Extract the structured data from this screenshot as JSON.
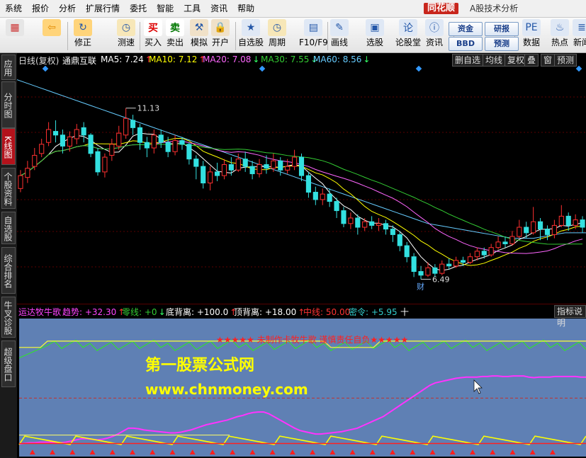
{
  "menu": [
    "系统",
    "报价",
    "分析",
    "扩展行情",
    "委托",
    "智能",
    "工具",
    "资讯",
    "帮助"
  ],
  "brand": {
    "logo": "同花顺",
    "subtitle": "A股技术分析"
  },
  "toolbar": {
    "items": [
      {
        "name": "color-button",
        "label": "",
        "icon": "grid-icon"
      },
      {
        "name": "back-button",
        "label": "",
        "icon": "left-arrow-icon"
      },
      {
        "name": "fix-button",
        "label": "修正",
        "icon": "fix-icon"
      },
      {
        "name": "speed-button",
        "label": "测速",
        "icon": "clock-icon"
      },
      {
        "name": "buy-button",
        "label": "买入",
        "icon": "buy-icon",
        "glyph": "买"
      },
      {
        "name": "sell-button",
        "label": "卖出",
        "icon": "sell-icon",
        "glyph": "卖"
      },
      {
        "name": "simulate-button",
        "label": "模拟",
        "icon": "hammer-icon"
      },
      {
        "name": "open-account-button",
        "label": "开户",
        "icon": "lock-icon"
      },
      {
        "name": "watchlist-button",
        "label": "自选股",
        "icon": "star-icon"
      },
      {
        "name": "period-button",
        "label": "周期",
        "icon": "clock-icon"
      },
      {
        "name": "f10-button",
        "label": "F10/F9",
        "icon": "document-icon"
      },
      {
        "name": "draw-button",
        "label": "画线",
        "icon": "pen-icon"
      },
      {
        "name": "select-stock-button",
        "label": "选股",
        "icon": "monitor-icon"
      },
      {
        "name": "forum-button",
        "label": "论股堂",
        "icon": "forum-icon"
      },
      {
        "name": "news-button",
        "label": "资讯",
        "icon": "info-icon"
      },
      {
        "name": "data-button",
        "label": "数据",
        "icon": "pe-icon"
      },
      {
        "name": "hot-button",
        "label": "热点",
        "icon": "fire-icon"
      },
      {
        "name": "new-button",
        "label": "新闻",
        "icon": "news-icon"
      }
    ],
    "boxes": [
      "资金",
      "研报",
      "BBD",
      "预测"
    ]
  },
  "lefttabs": [
    "应用",
    "分时图",
    "K线图",
    "个股资料",
    "自选股",
    "综合排名",
    "牛叉诊股",
    "超级盘口"
  ],
  "chart": {
    "period_label": "日线(复权)",
    "stock_name": "通鼎互联",
    "ma": [
      {
        "label": "MA5: 7.24",
        "arrow": "↑",
        "color": "#ffffff"
      },
      {
        "label": "MA10: 7.12",
        "arrow": "↑",
        "color": "#ffff00"
      },
      {
        "label": "MA20: 7.08",
        "arrow": "↓",
        "color": "#ff66ff"
      },
      {
        "label": "MA30: 7.55",
        "arrow": "↓",
        "color": "#33cc33"
      },
      {
        "label": "MA60: 8.56",
        "arrow": "↓",
        "color": "#66ccff"
      }
    ],
    "right_buttons": [
      "删自选",
      "均线",
      "复权",
      "叠",
      "窗",
      "预测"
    ],
    "high_label": "11.13",
    "low_label": "6.49",
    "cai_label": "财"
  },
  "indicator": {
    "name": "运达牧牛歌",
    "items": [
      {
        "label": "趋势: +32.30",
        "arrow": "↑",
        "color": "#ff44ff"
      },
      {
        "label": "零线: +0",
        "arrow": "↓",
        "color": "#33cc33"
      },
      {
        "label": "底背离: +100.0",
        "arrow": "↑",
        "color": "#ffffff"
      },
      {
        "label": "顶背离: +18.00",
        "arrow": "↑",
        "color": "#ffffff"
      },
      {
        "label": "中线: 50.00",
        "arrow": "",
        "color": "#ff3333"
      },
      {
        "label": "密令: +5.95",
        "arrow": "",
        "color": "#33cccc"
      }
    ],
    "right_button": "指标说明",
    "banner": "★★★★★ 未制作卡牧牛歌 谨慎责任自负★★★★★",
    "watermark_title": "第一股票公式网",
    "watermark_url": "www.chnmoney.com"
  },
  "colors": {
    "up": "#ff3030",
    "down": "#33e0e0",
    "ma5": "#ffffff",
    "ma10": "#ffff00",
    "ma20": "#ff66ff",
    "ma30": "#33cc33",
    "ma60": "#66ccff",
    "panel": "#5f80b4"
  },
  "chart_data": {
    "type": "candlestick",
    "price_ylim": [
      6.0,
      12.2
    ],
    "candles": [
      [
        8.95,
        9.3,
        9.45,
        8.85
      ],
      [
        9.25,
        9.5,
        9.7,
        9.1
      ],
      [
        9.55,
        9.85,
        10.05,
        9.45
      ],
      [
        9.9,
        10.15,
        10.3,
        9.8
      ],
      [
        10.2,
        10.55,
        10.75,
        10.1
      ],
      [
        10.5,
        10.4,
        10.8,
        10.2
      ],
      [
        10.4,
        10.1,
        10.55,
        9.9
      ],
      [
        10.1,
        10.35,
        10.5,
        9.95
      ],
      [
        10.3,
        10.55,
        10.7,
        10.15
      ],
      [
        10.6,
        10.4,
        10.75,
        10.2
      ],
      [
        10.4,
        9.9,
        10.45,
        9.8
      ],
      [
        9.95,
        9.4,
        10.05,
        9.3
      ],
      [
        9.4,
        9.8,
        9.9,
        9.25
      ],
      [
        9.85,
        10.15,
        10.3,
        9.7
      ],
      [
        10.1,
        10.45,
        10.65,
        10.0
      ],
      [
        10.4,
        10.85,
        11.13,
        10.3
      ],
      [
        10.8,
        10.6,
        10.95,
        10.4
      ],
      [
        10.6,
        10.2,
        10.7,
        10.0
      ],
      [
        10.2,
        10.05,
        10.35,
        9.8
      ],
      [
        10.05,
        10.4,
        10.55,
        9.9
      ],
      [
        10.4,
        10.2,
        10.55,
        10.05
      ],
      [
        10.2,
        9.95,
        10.35,
        9.8
      ],
      [
        9.95,
        10.25,
        10.4,
        9.85
      ],
      [
        10.25,
        10.15,
        10.35,
        10.0
      ],
      [
        10.15,
        9.75,
        10.2,
        9.6
      ],
      [
        9.75,
        9.55,
        9.85,
        9.2
      ],
      [
        9.55,
        9.1,
        9.7,
        8.95
      ],
      [
        9.1,
        9.4,
        9.55,
        8.9
      ],
      [
        9.4,
        9.3,
        9.65,
        9.15
      ],
      [
        9.3,
        9.6,
        9.75,
        9.2
      ],
      [
        9.6,
        9.45,
        9.8,
        9.3
      ],
      [
        9.45,
        9.75,
        9.9,
        9.4
      ],
      [
        9.75,
        9.55,
        9.95,
        9.4
      ],
      [
        9.55,
        9.35,
        9.7,
        9.2
      ],
      [
        9.35,
        9.6,
        9.75,
        9.25
      ],
      [
        9.6,
        9.5,
        9.85,
        9.35
      ],
      [
        9.5,
        9.7,
        9.9,
        9.4
      ],
      [
        9.7,
        9.45,
        9.8,
        9.3
      ],
      [
        9.45,
        9.55,
        9.75,
        9.35
      ],
      [
        9.55,
        9.8,
        10.0,
        9.45
      ],
      [
        9.8,
        9.3,
        9.9,
        9.15
      ],
      [
        9.3,
        8.85,
        9.4,
        8.7
      ],
      [
        8.85,
        8.65,
        9.0,
        8.5
      ],
      [
        8.65,
        8.8,
        8.95,
        8.5
      ],
      [
        8.8,
        8.6,
        8.95,
        8.45
      ],
      [
        8.6,
        8.35,
        8.7,
        8.15
      ],
      [
        8.35,
        8.0,
        8.45,
        7.9
      ],
      [
        8.0,
        8.15,
        8.3,
        7.85
      ],
      [
        8.15,
        7.9,
        8.25,
        7.7
      ],
      [
        7.9,
        8.05,
        8.15,
        7.8
      ],
      [
        8.05,
        7.95,
        8.2,
        7.85
      ],
      [
        7.95,
        8.0,
        8.15,
        7.8
      ],
      [
        8.0,
        7.85,
        8.1,
        7.7
      ],
      [
        7.85,
        7.7,
        7.95,
        7.5
      ],
      [
        7.7,
        7.4,
        7.8,
        7.25
      ],
      [
        7.4,
        7.1,
        7.5,
        6.95
      ],
      [
        7.1,
        6.7,
        7.2,
        6.55
      ],
      [
        6.7,
        6.6,
        6.85,
        6.49
      ],
      [
        6.6,
        6.8,
        6.95,
        6.55
      ],
      [
        6.8,
        6.65,
        6.9,
        6.55
      ],
      [
        6.65,
        6.9,
        7.0,
        6.6
      ],
      [
        6.9,
        6.85,
        7.05,
        6.75
      ],
      [
        6.85,
        7.0,
        7.1,
        6.8
      ],
      [
        7.0,
        6.95,
        7.1,
        6.85
      ],
      [
        6.95,
        7.1,
        7.2,
        6.9
      ],
      [
        7.1,
        7.25,
        7.35,
        7.0
      ],
      [
        7.25,
        7.15,
        7.35,
        7.05
      ],
      [
        7.15,
        7.35,
        7.45,
        7.1
      ],
      [
        7.35,
        7.5,
        7.65,
        7.3
      ],
      [
        7.5,
        7.45,
        7.65,
        7.35
      ],
      [
        7.45,
        7.65,
        7.8,
        7.4
      ],
      [
        7.65,
        7.9,
        8.1,
        7.6
      ],
      [
        7.9,
        7.75,
        8.05,
        7.6
      ],
      [
        7.75,
        8.05,
        8.45,
        7.7
      ],
      [
        8.05,
        7.85,
        8.15,
        7.55
      ],
      [
        7.85,
        7.7,
        7.95,
        7.55
      ],
      [
        7.7,
        7.95,
        8.1,
        7.6
      ],
      [
        7.95,
        8.2,
        8.5,
        7.9
      ],
      [
        8.2,
        7.95,
        8.3,
        7.8
      ],
      [
        7.95,
        8.1,
        8.25,
        7.85
      ],
      [
        8.1,
        7.9,
        8.2,
        7.75
      ]
    ],
    "ma60": [
      11.9,
      11.8,
      11.7,
      11.6,
      11.5,
      11.4,
      11.3,
      11.2,
      11.1,
      11.0,
      10.9,
      10.8,
      10.7,
      10.6,
      10.5,
      10.4,
      10.3,
      10.2,
      10.1,
      10.0,
      9.9,
      9.8,
      9.7,
      9.6,
      9.5,
      9.4,
      9.3,
      9.2,
      9.1,
      9.0,
      8.9,
      8.8,
      8.7,
      8.6,
      8.5,
      8.4,
      8.3,
      8.2,
      8.1,
      8.0,
      7.95,
      7.9,
      7.85,
      7.8,
      7.75,
      7.7,
      7.65,
      7.6,
      7.6,
      7.6,
      7.65,
      7.7,
      7.75,
      7.75,
      7.75
    ],
    "osc_ylim": [
      0,
      120
    ],
    "trend": [
      3,
      4,
      5,
      5,
      6,
      6,
      6,
      5,
      5,
      6,
      8,
      10,
      12,
      12,
      11,
      10,
      11,
      13,
      16,
      20,
      25,
      30,
      30,
      29,
      27,
      26,
      25,
      24,
      23,
      22,
      22,
      23,
      25,
      27,
      30,
      33,
      36,
      38,
      40,
      42,
      44,
      47,
      50,
      52,
      55,
      57,
      58,
      58,
      55,
      50,
      45,
      40,
      35,
      30,
      26,
      24,
      22,
      20,
      20,
      21,
      22,
      23,
      24,
      26,
      28,
      30,
      34,
      38,
      42,
      46,
      50,
      56,
      62,
      68,
      74,
      80,
      86,
      92,
      98,
      104,
      108,
      110,
      112,
      114,
      116,
      117,
      118,
      118,
      118,
      119,
      119,
      120,
      120,
      119,
      119,
      120,
      120,
      120,
      118,
      117,
      118,
      118,
      118,
      119,
      119,
      119,
      119,
      119,
      118,
      118
    ],
    "midline": [
      10,
      12,
      14,
      16,
      18,
      20,
      22,
      24,
      26,
      28,
      30,
      32,
      30,
      28,
      26,
      24,
      26,
      28,
      30,
      32,
      34,
      36,
      38,
      40,
      42,
      44,
      46,
      48,
      50,
      52,
      54,
      56,
      54,
      52,
      50,
      48,
      50,
      52,
      54,
      56,
      58,
      56,
      54,
      52,
      50,
      48,
      50,
      52,
      54,
      56,
      58,
      60,
      58,
      56,
      54,
      52,
      50,
      48,
      46,
      44,
      45,
      46,
      47,
      48,
      49,
      50,
      51,
      52,
      53,
      54,
      55,
      56,
      57,
      58,
      59,
      60,
      61,
      62,
      63,
      64,
      65,
      66,
      67,
      68
    ],
    "zero_line": 0,
    "mid_value": 50,
    "red_arrow_indices": [
      2,
      5,
      8,
      11,
      14,
      17,
      20,
      23,
      26,
      29,
      32,
      35,
      38,
      41,
      44,
      47,
      50,
      53,
      56,
      59,
      62,
      65,
      68,
      71,
      74,
      77,
      80
    ]
  }
}
